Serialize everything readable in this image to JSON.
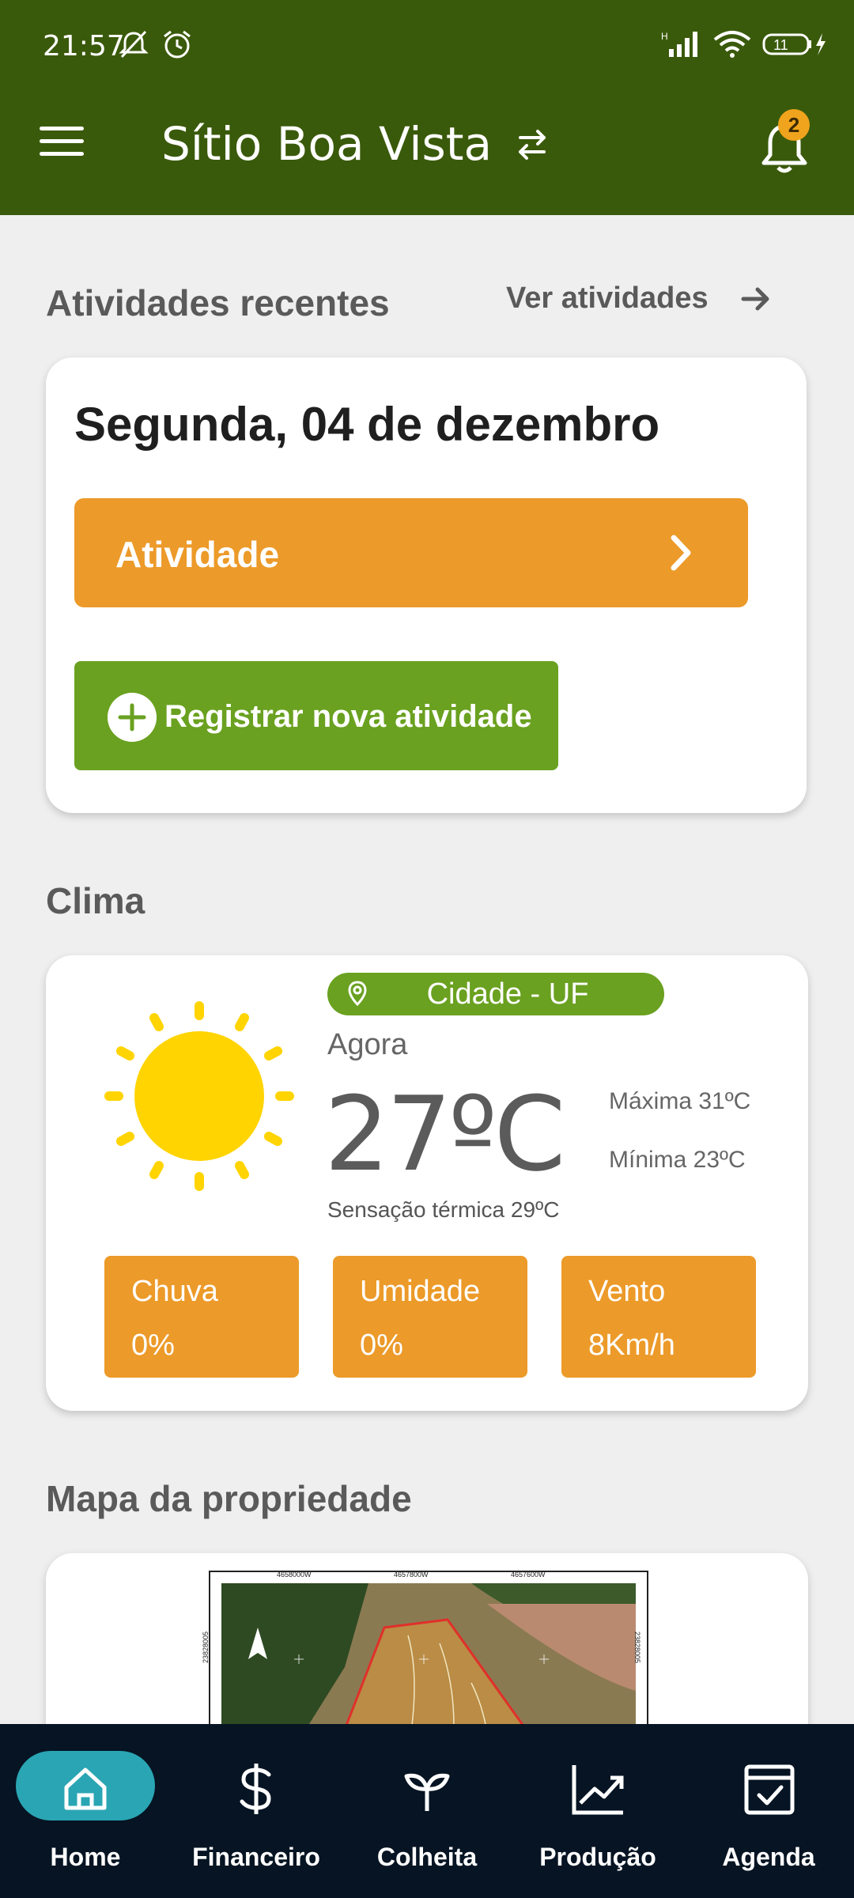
{
  "status": {
    "time": "21:57"
  },
  "header": {
    "title": "Sítio Boa Vista",
    "notifications": "2"
  },
  "recent": {
    "title": "Atividades recentes",
    "see_all": "Ver atividades",
    "date": "Segunda, 04 de dezembro",
    "activity": "Atividade",
    "register": "Registrar nova atividade"
  },
  "weather": {
    "title": "Clima",
    "city": "Cidade - UF",
    "now": "Agora",
    "temp": "27ºC",
    "max": "Máxima 31ºC",
    "min": "Mínima 23ºC",
    "feels": "Sensação térmica 29ºC",
    "stats": [
      {
        "label": "Chuva",
        "value": "0%"
      },
      {
        "label": "Umidade",
        "value": "0%"
      },
      {
        "label": "Vento",
        "value": "8Km/h"
      }
    ]
  },
  "map": {
    "title": "Mapa da propriedade",
    "coords_top": [
      "4658000W",
      "4657800W",
      "4657600W"
    ],
    "coord_side": "23828005"
  },
  "nav": [
    {
      "label": "Home",
      "icon": "home-icon"
    },
    {
      "label": "Financeiro",
      "icon": "dollar-icon"
    },
    {
      "label": "Colheita",
      "icon": "sprout-icon"
    },
    {
      "label": "Produção",
      "icon": "chart-up-icon"
    },
    {
      "label": "Agenda",
      "icon": "calendar-check-icon"
    }
  ],
  "colors": {
    "header": "#3a5a0b",
    "green_button": "#6aa120",
    "orange": "#ec9a29",
    "nav_bg": "#061423",
    "nav_active": "#2aa5b3",
    "badge": "#f0a31c"
  }
}
